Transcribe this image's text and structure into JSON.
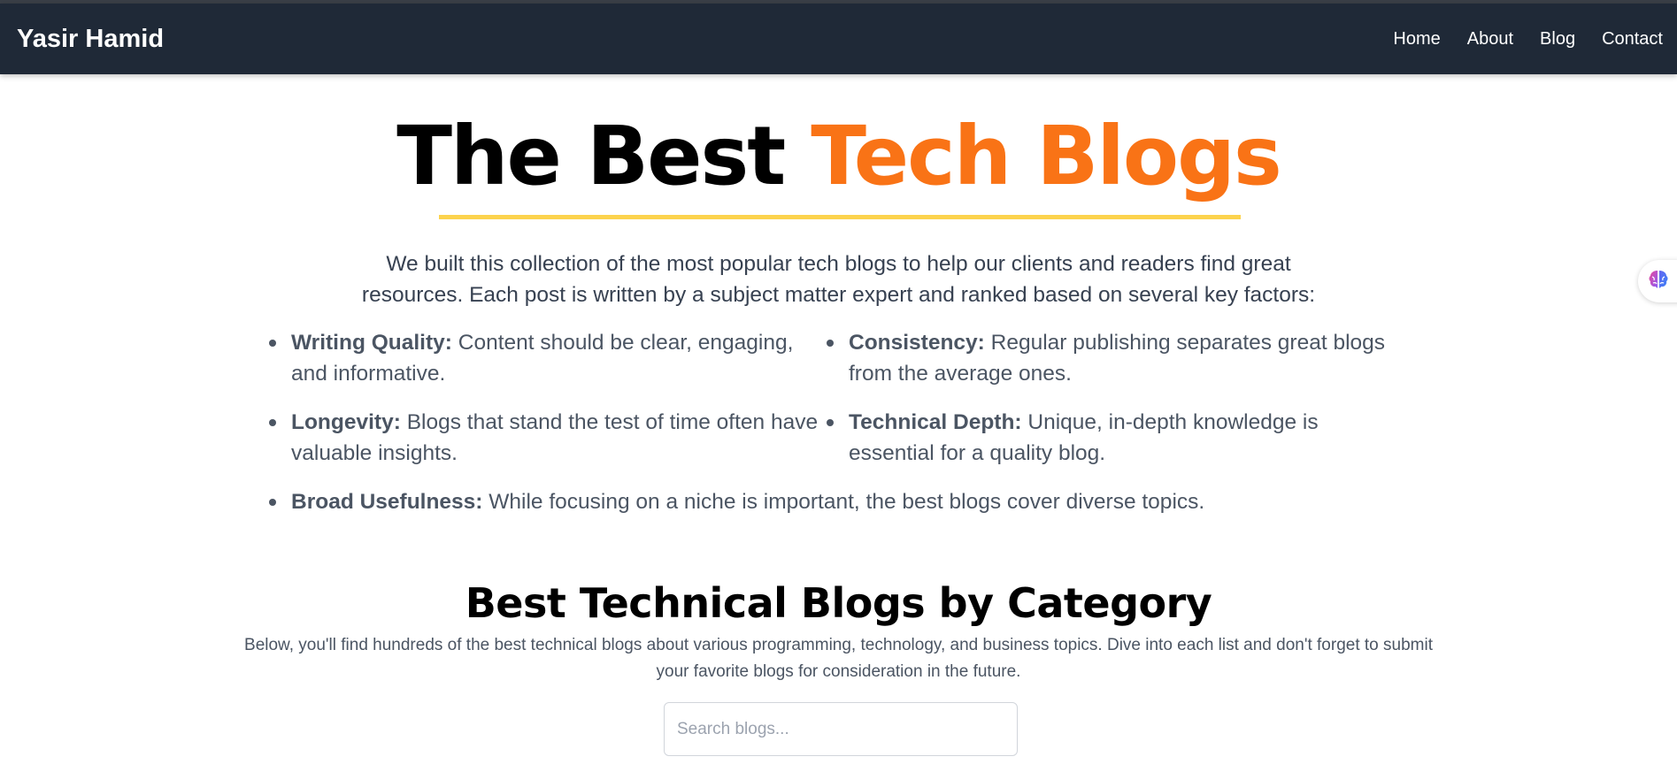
{
  "navbar": {
    "brand": "Yasir Hamid",
    "links": [
      "Home",
      "About",
      "Blog",
      "Contact"
    ]
  },
  "hero": {
    "title_part1": "The Best",
    "title_part2": "Tech Blogs",
    "intro": "We built this collection of the most popular tech blogs to help our clients and readers find great resources. Each post is written by a subject matter expert and ranked based on several key factors:"
  },
  "factors": [
    {
      "name": "Writing Quality:",
      "text": "Content should be clear, engaging, and informative."
    },
    {
      "name": "Consistency:",
      "text": "Regular publishing separates great blogs from the average ones."
    },
    {
      "name": "Longevity:",
      "text": "Blogs that stand the test of time often have valuable insights."
    },
    {
      "name": "Technical Depth:",
      "text": "Unique, in-depth knowledge is essential for a quality blog."
    },
    {
      "name": "Broad Usefulness:",
      "text": "While focusing on a niche is important, the best blogs cover diverse topics."
    }
  ],
  "categories_section": {
    "title": "Best Technical Blogs by Category",
    "description": "Below, you'll find hundreds of the best technical blogs about various programming, technology, and business topics. Dive into each list and don't forget to submit your favorite blogs for consideration in the future."
  },
  "search": {
    "placeholder": "Search blogs...",
    "value": ""
  },
  "float_widget": {
    "icon": "brain-icon"
  },
  "colors": {
    "navbar_bg": "#1f2937",
    "accent": "#f97316",
    "underline": "#fcd34d"
  }
}
